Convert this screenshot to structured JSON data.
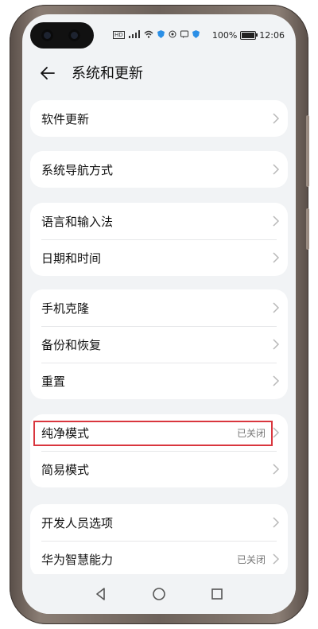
{
  "status_bar": {
    "battery_percent": "100%",
    "time": "12:06",
    "icons": [
      "hd-icon",
      "signal-icon",
      "wifi-icon",
      "shield-icon",
      "vibrate-icon",
      "message-icon",
      "shield-icon"
    ]
  },
  "header": {
    "title": "系统和更新",
    "back_icon": "arrow-left-icon"
  },
  "groups": [
    {
      "items": [
        {
          "label": "软件更新"
        }
      ]
    },
    {
      "items": [
        {
          "label": "系统导航方式"
        }
      ]
    },
    {
      "items": [
        {
          "label": "语言和输入法"
        },
        {
          "label": "日期和时间"
        }
      ]
    },
    {
      "items": [
        {
          "label": "手机克隆"
        },
        {
          "label": "备份和恢复"
        },
        {
          "label": "重置"
        }
      ]
    },
    {
      "items": [
        {
          "label": "纯净模式",
          "value": "已关闭"
        },
        {
          "label": "简易模式"
        }
      ]
    },
    {
      "items": [
        {
          "label": "开发人员选项"
        },
        {
          "label": "华为智慧能力",
          "value": "已关闭"
        }
      ]
    }
  ],
  "nav": {
    "back_icon": "triangle-back-icon",
    "home_icon": "circle-home-icon",
    "recents_icon": "square-recents-icon"
  },
  "colors": {
    "highlight_border": "#d9363e",
    "screen_bg": "#f1f3f5",
    "card_bg": "#ffffff"
  }
}
